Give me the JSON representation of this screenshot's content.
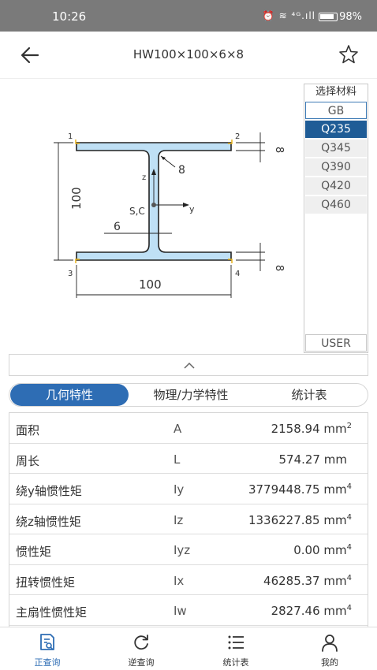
{
  "status_bar": {
    "time": "10:26",
    "signal": "⁴ᴳ.ıll",
    "battery": "98%"
  },
  "app_bar": {
    "title": "HW100×100×6×8"
  },
  "diagram": {
    "point_1": "1",
    "point_2": "2",
    "point_3": "3",
    "point_4": "4",
    "flange_top": "8",
    "flange_bottom": "8",
    "fillet": "8",
    "web": "6",
    "height": "100",
    "width": "100",
    "axis_z": "z",
    "axis_y": "y",
    "center": "S,C"
  },
  "materials": {
    "title": "选择材料",
    "items": [
      "GB",
      "Q235",
      "Q345",
      "Q390",
      "Q420",
      "Q460"
    ],
    "selected": "Q235",
    "user": "USER"
  },
  "tabs": [
    "几何特性",
    "物理/力学特性",
    "统计表"
  ],
  "active_tab": "几何特性",
  "properties": [
    {
      "name": "面积",
      "symbol": "A",
      "value": "2158.94",
      "unit": "mm",
      "exp": "2"
    },
    {
      "name": "周长",
      "symbol": "L",
      "value": "574.27",
      "unit": "mm",
      "exp": ""
    },
    {
      "name": "绕y轴惯性矩",
      "symbol": "Iy",
      "value": "3779448.75",
      "unit": "mm",
      "exp": "4"
    },
    {
      "name": "绕z轴惯性矩",
      "symbol": "Iz",
      "value": "1336227.85",
      "unit": "mm",
      "exp": "4"
    },
    {
      "name": "惯性矩",
      "symbol": "Iyz",
      "value": "0.00",
      "unit": "mm",
      "exp": "4"
    },
    {
      "name": "扭转惯性矩",
      "symbol": "Ix",
      "value": "46285.37",
      "unit": "mm",
      "exp": "4"
    },
    {
      "name": "主扇性惯性矩",
      "symbol": "Iw",
      "value": "2827.46",
      "unit": "mm",
      "exp": "4"
    }
  ],
  "bottom_nav": [
    "正查询",
    "逆查询",
    "统计表",
    "我的"
  ],
  "colors": {
    "accent": "#2e6db4",
    "section_fill": "#bfe0f5",
    "point_marker": "#e8b41c",
    "status_bar": "#7a7a7a"
  }
}
